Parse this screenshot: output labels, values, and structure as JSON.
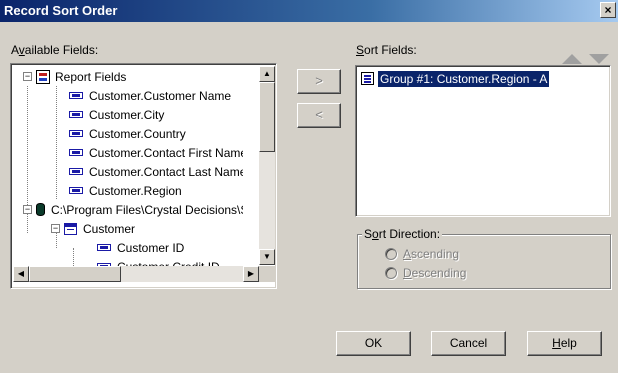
{
  "window": {
    "title": "Record Sort Order",
    "close_glyph": "×"
  },
  "available_fields": {
    "label_accel": "v",
    "label_pre": "A",
    "label_post": "ailable Fields:",
    "tree": [
      {
        "label": "Report Fields",
        "icon": "report-fields-icon",
        "expander": "−"
      },
      {
        "label": "Customer.Customer Name",
        "icon": "field-icon"
      },
      {
        "label": "Customer.City",
        "icon": "field-icon"
      },
      {
        "label": "Customer.Country",
        "icon": "field-icon"
      },
      {
        "label": "Customer.Contact First Name",
        "icon": "field-icon"
      },
      {
        "label": "Customer.Contact Last Name",
        "icon": "field-icon"
      },
      {
        "label": "Customer.Region",
        "icon": "field-icon"
      },
      {
        "label": "C:\\Program Files\\Crystal Decisions\\Samples\\Database\\xtreme.mdb",
        "icon": "database-icon",
        "expander": "−"
      },
      {
        "label": "Customer",
        "icon": "table-icon",
        "expander": "−"
      },
      {
        "label": "Customer ID",
        "icon": "field-icon"
      },
      {
        "label": "Customer Credit ID",
        "icon": "field-icon"
      }
    ]
  },
  "transfer_buttons": {
    "add": ">",
    "remove": "<"
  },
  "sort_fields": {
    "label_accel": "S",
    "label_post": "ort Fields:",
    "items": [
      {
        "label": "Group #1: Customer.Region - A"
      }
    ]
  },
  "sort_direction": {
    "label_pre": "S",
    "label_accel": "o",
    "label_post": "rt Direction:",
    "ascending_accel": "A",
    "ascending_post": "scending",
    "descending_accel": "D",
    "descending_post": "escending"
  },
  "buttons": {
    "ok": "OK",
    "cancel": "Cancel",
    "help_accel": "H",
    "help_post": "elp"
  },
  "scroll_glyphs": {
    "up": "▲",
    "down": "▼",
    "left": "◀",
    "right": "▶"
  }
}
